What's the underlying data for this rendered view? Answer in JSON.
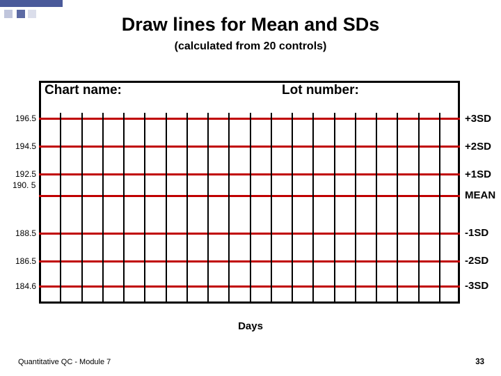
{
  "title": "Draw lines for Mean and SDs",
  "subtitle": "(calculated from 20 controls)",
  "chart_label_left": "Chart name:",
  "chart_label_right": "Lot number:",
  "xaxis": "Days",
  "footer": "Quantitative QC - Module 7",
  "page_number": "33",
  "chart_data": {
    "type": "line",
    "title": "Levey-Jennings template",
    "xlabel": "Days",
    "ylabel": "",
    "ylim": [
      184.6,
      196.5
    ],
    "vertical_gridlines": 19,
    "reference_lines": [
      {
        "label": "+3SD",
        "value": 196.5
      },
      {
        "label": "+2SD",
        "value": 194.5
      },
      {
        "label": "+1SD",
        "value": 192.5
      },
      {
        "label": "MEAN",
        "value": 190.5
      },
      {
        "label": "-1SD",
        "value": 188.5
      },
      {
        "label": "-2SD",
        "value": 186.5
      },
      {
        "label": "-3SD",
        "value": 184.6
      }
    ]
  },
  "left_value_190": "   190. 5"
}
